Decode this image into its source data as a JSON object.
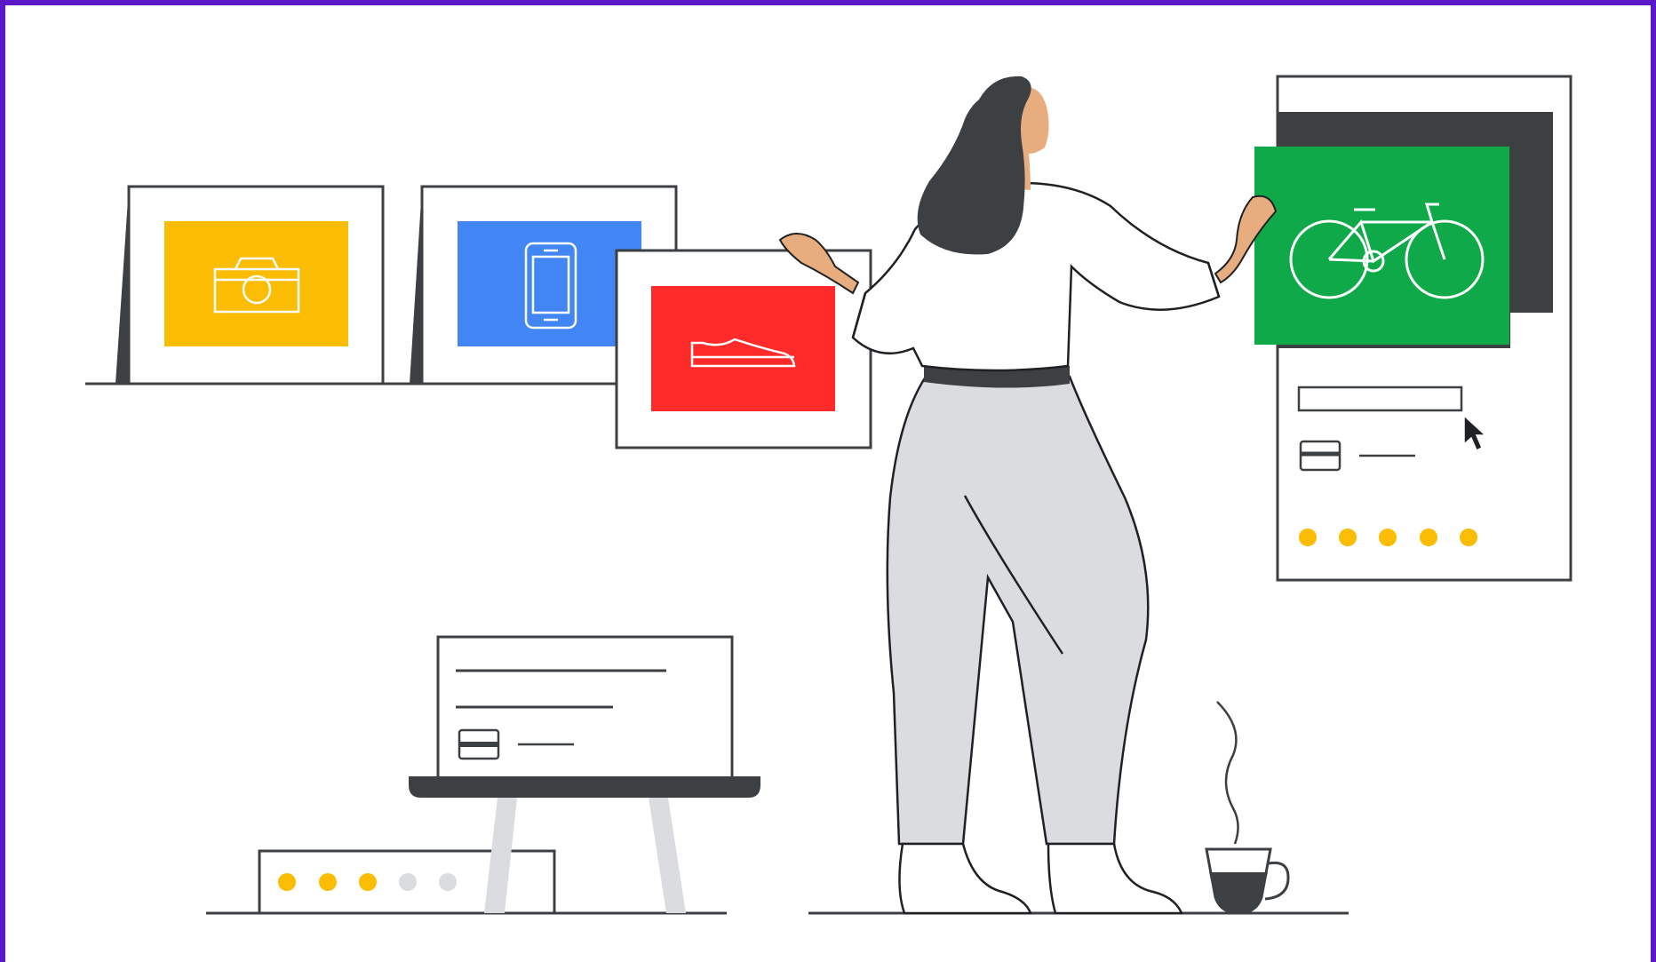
{
  "scene": {
    "description_free": true
  },
  "colors": {
    "frame": "#5b18c9",
    "background": "#ffffff",
    "ink": "#3c4043",
    "yellow": "#fbbc04",
    "blue": "#4285f4",
    "red": "#ff2a2a",
    "green": "#0fa94a",
    "skin": "#e7ad7e",
    "pants": "#dadce0",
    "dot_gray": "#dadce0"
  },
  "icons": {
    "card1": "camera-icon",
    "card2": "smartphone-icon",
    "card3": "shoe-icon",
    "card4": "bicycle-icon",
    "cursor": "mouse-pointer-icon",
    "mug": "coffee-cup-icon"
  },
  "rating_panel": {
    "filled": 5,
    "total": 5
  },
  "desk_box_rating": {
    "filled": 3,
    "total": 5
  }
}
